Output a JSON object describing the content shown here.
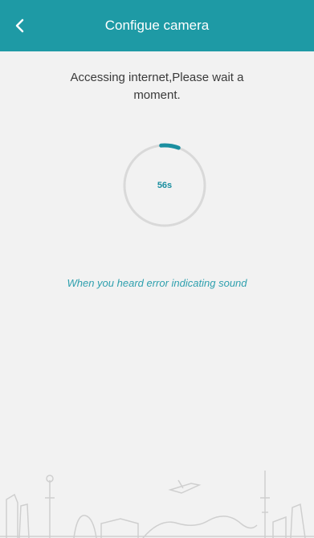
{
  "header": {
    "title": "Configue camera"
  },
  "status": {
    "message": "Accessing internet,Please wait a moment."
  },
  "countdown": {
    "label": "56s",
    "progress_fraction": 0.07
  },
  "help": {
    "link_text": "When you heard error indicating sound"
  },
  "colors": {
    "header": "#1e9aa5",
    "accent": "#1b8fa0",
    "link": "#2fa0ae",
    "background": "#f2f2f2"
  }
}
